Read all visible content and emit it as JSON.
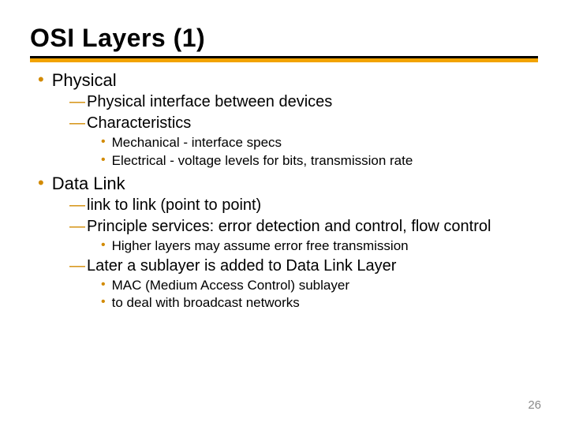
{
  "title": "OSI Layers (1)",
  "page_number": "26",
  "colors": {
    "accent": "#f2a300",
    "bullet": "#d28a00"
  },
  "sections": [
    {
      "label": "Physical",
      "subs": [
        {
          "label": "Physical interface between devices"
        },
        {
          "label": "Characteristics",
          "items": [
            "Mechanical - interface specs",
            "Electrical - voltage levels for bits, transmission rate"
          ]
        }
      ]
    },
    {
      "label": "Data Link",
      "subs": [
        {
          "label": "link to link (point to point)"
        },
        {
          "label": "Principle services: error detection and control, flow control",
          "items": [
            "Higher layers may assume error free transmission"
          ]
        },
        {
          "label": "Later a sublayer is added to Data Link Layer",
          "items": [
            "MAC (Medium Access Control) sublayer",
            "to deal with broadcast networks"
          ]
        }
      ]
    }
  ]
}
